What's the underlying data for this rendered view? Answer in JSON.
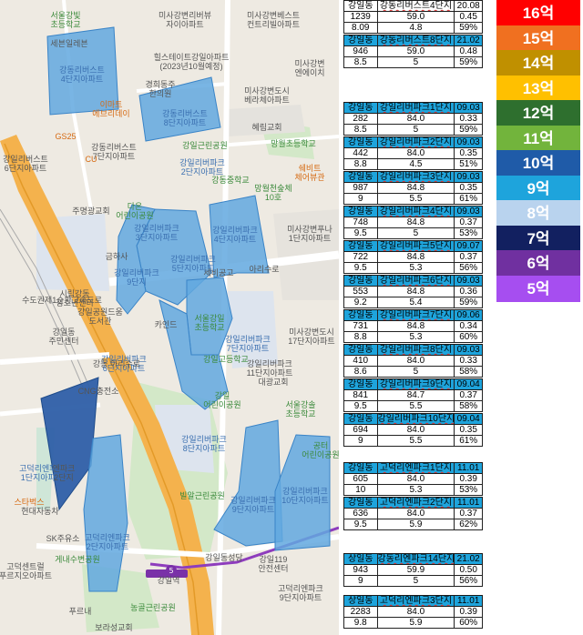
{
  "map": {
    "labels": [
      {
        "t": "서울강빛\n초등학교",
        "k": "grn"
      },
      {
        "t": "미사강변리버뷰\n자이아파트",
        "k": ""
      },
      {
        "t": "미사강변베스트\n컨트리빌아파트",
        "k": ""
      },
      {
        "t": "세븐일레븐",
        "k": ""
      },
      {
        "t": "강동리버스트\n4단지아파트",
        "k": "cx"
      },
      {
        "t": "힐스테이트강일아파트\n(2023년10월예정)",
        "k": ""
      },
      {
        "t": "미사강변\n엔에이치",
        "k": ""
      },
      {
        "t": "경희동주\n한의원",
        "k": ""
      },
      {
        "t": "미사강변도시\n베라체아파트",
        "k": ""
      },
      {
        "t": "이마트\n에브리데이",
        "k": "orn"
      },
      {
        "t": "강동리버스트\n8단지아파트",
        "k": "cx"
      },
      {
        "t": "혜림교회",
        "k": ""
      },
      {
        "t": "GS25",
        "k": "orn"
      },
      {
        "t": "강동리버스트\n7단지아파트",
        "k": ""
      },
      {
        "t": "강일근린공원",
        "k": "grn"
      },
      {
        "t": "망월초등학교",
        "k": "grn"
      },
      {
        "t": "강일리버파크\n2단지아파트",
        "k": "cx"
      },
      {
        "t": "강일리버스트\n6단지아파트",
        "k": ""
      },
      {
        "t": "CU",
        "k": "orn"
      },
      {
        "t": "쉐비트\n체어뷰관",
        "k": "orn"
      },
      {
        "t": "강동중학교",
        "k": "grn"
      },
      {
        "t": "망월천숲체\n10호",
        "k": "grn"
      },
      {
        "t": "주명광교회",
        "k": ""
      },
      {
        "t": "다온\n어린이공원",
        "k": "grn"
      },
      {
        "t": "미사강변푸나\n1단지아파트",
        "k": ""
      },
      {
        "t": "강일리버파크\n3단지아파트",
        "k": "cx"
      },
      {
        "t": "강일리버파크\n4단지아파트",
        "k": "cx"
      },
      {
        "t": "강일리버파크\n5단지아파트",
        "k": "cx"
      },
      {
        "t": "금하사",
        "k": ""
      },
      {
        "t": "세비공고",
        "k": ""
      },
      {
        "t": "아리수로",
        "k": ""
      },
      {
        "t": "강일리버파크\n9단지",
        "k": "cx"
      },
      {
        "t": "시립강동\n청소년센터",
        "k": ""
      },
      {
        "t": "강일공원드움\n도서관",
        "k": ""
      },
      {
        "t": "강일리버파크\n7단지아파트",
        "k": "cx"
      },
      {
        "t": "서울강일\n초등학교",
        "k": "grn"
      },
      {
        "t": "강일동\n주민센터",
        "k": ""
      },
      {
        "t": "카인드",
        "k": ""
      },
      {
        "t": "미사강변도시\n17단지아파트",
        "k": ""
      },
      {
        "t": "강일리버파크\n6단지아파트",
        "k": "cx"
      },
      {
        "t": "강일고등학교",
        "k": "grn"
      },
      {
        "t": "강일리버파크\n11단지아파트",
        "k": ""
      },
      {
        "t": "CNG충전소",
        "k": ""
      },
      {
        "t": "대광교회",
        "k": ""
      },
      {
        "t": "강일\n어린이공원",
        "k": "grn"
      },
      {
        "t": "서울강솔\n초등학교",
        "k": "grn"
      },
      {
        "t": "강일리버파크\n8단지아파트",
        "k": "cx"
      },
      {
        "t": "공터\n어린이공원",
        "k": "grn"
      },
      {
        "t": "고덕리엔파크\n1단지아파트",
        "k": "cx"
      },
      {
        "t": "빌알근린공원",
        "k": "grn"
      },
      {
        "t": "강일리버파크\n9단지아파트",
        "k": "cx"
      },
      {
        "t": "강일리버파크\n10단지아파트",
        "k": "cx"
      },
      {
        "t": "현대자동차",
        "k": ""
      },
      {
        "t": "SK주유소",
        "k": ""
      },
      {
        "t": "고덕리엔파크\n2단지아파트",
        "k": "cx"
      },
      {
        "t": "게내수변공원",
        "k": "grn"
      },
      {
        "t": "고덕센트럴\n푸르지오아파트",
        "k": ""
      },
      {
        "t": "강일동성당",
        "k": ""
      },
      {
        "t": "강일119\n안전센터",
        "k": ""
      },
      {
        "t": "스타벅스",
        "k": "orn"
      },
      {
        "t": "강일역",
        "k": ""
      },
      {
        "t": "푸르내",
        "k": ""
      },
      {
        "t": "고덕리엔파크\n9단지아파트",
        "k": ""
      },
      {
        "t": "농골근린공원",
        "k": "grn"
      },
      {
        "t": "보라성교회",
        "k": ""
      },
      {
        "t": "강동 아리수로",
        "k": ""
      },
      {
        "t": "수도권제1순환고속도로",
        "k": ""
      },
      {
        "t": "엔파크\n2단지",
        "k": ""
      }
    ]
  },
  "tables": [
    {
      "head": [
        "강일동",
        "강동리버스트4단지",
        "20.08"
      ],
      "hs": "cur",
      "rows": [
        [
          "1239",
          "59.0",
          "0.45"
        ],
        [
          "8.09",
          "4.8",
          "59%"
        ]
      ]
    },
    {
      "head": [
        "강일동",
        "강동리버스트8단지",
        "21.02"
      ],
      "hs": "",
      "rows": [
        [
          "946",
          "59.0",
          "0.48"
        ],
        [
          "8.5",
          "5",
          "59%"
        ]
      ]
    },
    {
      "head": [
        "강일동",
        "강일리버파크1단지",
        "09.03"
      ],
      "hs": "",
      "rows": [
        [
          "282",
          "84.0",
          "0.33"
        ],
        [
          "8.5",
          "5",
          "59%"
        ]
      ]
    },
    {
      "head": [
        "강일동",
        "강일리버파크2단지",
        "09.03"
      ],
      "hs": "",
      "rows": [
        [
          "442",
          "84.0",
          "0.35"
        ],
        [
          "8.8",
          "4.5",
          "51%"
        ]
      ]
    },
    {
      "head": [
        "강일동",
        "강일리버파크3단지",
        "09.03"
      ],
      "hs": "",
      "rows": [
        [
          "987",
          "84.8",
          "0.35"
        ],
        [
          "9",
          "5.5",
          "61%"
        ]
      ]
    },
    {
      "head": [
        "강일동",
        "강일리버파크4단지",
        "09.03"
      ],
      "hs": "",
      "rows": [
        [
          "748",
          "84.8",
          "0.37"
        ],
        [
          "9.5",
          "5",
          "53%"
        ]
      ]
    },
    {
      "head": [
        "강일동",
        "강일리버파크5단지",
        "09.07"
      ],
      "hs": "",
      "rows": [
        [
          "722",
          "84.8",
          "0.37"
        ],
        [
          "9.5",
          "5.3",
          "56%"
        ]
      ]
    },
    {
      "head": [
        "강일동",
        "강일리버파크6단지",
        "09.03"
      ],
      "hs": "",
      "rows": [
        [
          "553",
          "84.8",
          "0.36"
        ],
        [
          "9.2",
          "5.4",
          "59%"
        ]
      ]
    },
    {
      "head": [
        "강일동",
        "강일리버파크7단지",
        "09.06"
      ],
      "hs": "",
      "rows": [
        [
          "731",
          "84.8",
          "0.34"
        ],
        [
          "8.8",
          "5.3",
          "60%"
        ]
      ]
    },
    {
      "head": [
        "강일동",
        "강일리버파크8단지",
        "09.03"
      ],
      "hs": "",
      "rows": [
        [
          "410",
          "84.0",
          "0.33"
        ],
        [
          "8.6",
          "5",
          "58%"
        ]
      ]
    },
    {
      "head": [
        "강일동",
        "강일리버파크9단지",
        "09.04"
      ],
      "hs": "",
      "rows": [
        [
          "841",
          "84.7",
          "0.37"
        ],
        [
          "9.5",
          "5.5",
          "58%"
        ]
      ]
    },
    {
      "head": [
        "강일동",
        "강일리버파크10단지",
        "09.04"
      ],
      "hs": "",
      "rows": [
        [
          "694",
          "84.0",
          "0.35"
        ],
        [
          "9",
          "5.5",
          "61%"
        ]
      ]
    },
    {
      "head": [
        "강일동",
        "고덕리엔파크1단지",
        "11.01"
      ],
      "hs": "",
      "rows": [
        [
          "605",
          "84.0",
          "0.39"
        ],
        [
          "10",
          "5.3",
          "53%"
        ]
      ]
    },
    {
      "head": [
        "강일동",
        "고덕리엔파크2단지",
        "11.01"
      ],
      "hs": "",
      "rows": [
        [
          "636",
          "84.0",
          "0.37"
        ],
        [
          "9.5",
          "5.9",
          "62%"
        ]
      ]
    },
    {
      "head": [
        "상일동",
        "강동리엔파크14단지",
        "21.02"
      ],
      "hs": "",
      "rows": [
        [
          "943",
          "59.9",
          "0.50"
        ],
        [
          "9",
          "5",
          "56%"
        ]
      ]
    },
    {
      "head": [
        "상일동",
        "고덕리엔파크3단지",
        "11.01"
      ],
      "hs": "",
      "rows": [
        [
          "2283",
          "84.0",
          "0.39"
        ],
        [
          "9.8",
          "5.9",
          "60%"
        ]
      ]
    }
  ],
  "legend": [
    {
      "label": "16억",
      "color": "#ff0000"
    },
    {
      "label": "15억",
      "color": "#f07020"
    },
    {
      "label": "14억",
      "color": "#c09000"
    },
    {
      "label": "13억",
      "color": "#ffc000"
    },
    {
      "label": "12억",
      "color": "#2e6f2e"
    },
    {
      "label": "11억",
      "color": "#72b43c"
    },
    {
      "label": "10억",
      "color": "#1f5ba8"
    },
    {
      "label": "9억",
      "color": "#1ea4dc"
    },
    {
      "label": "8억",
      "color": "#b9d3ee"
    },
    {
      "label": "7억",
      "color": "#122060"
    },
    {
      "label": "6억",
      "color": "#7030a0"
    },
    {
      "label": "5억",
      "color": "#a64ef0"
    }
  ]
}
